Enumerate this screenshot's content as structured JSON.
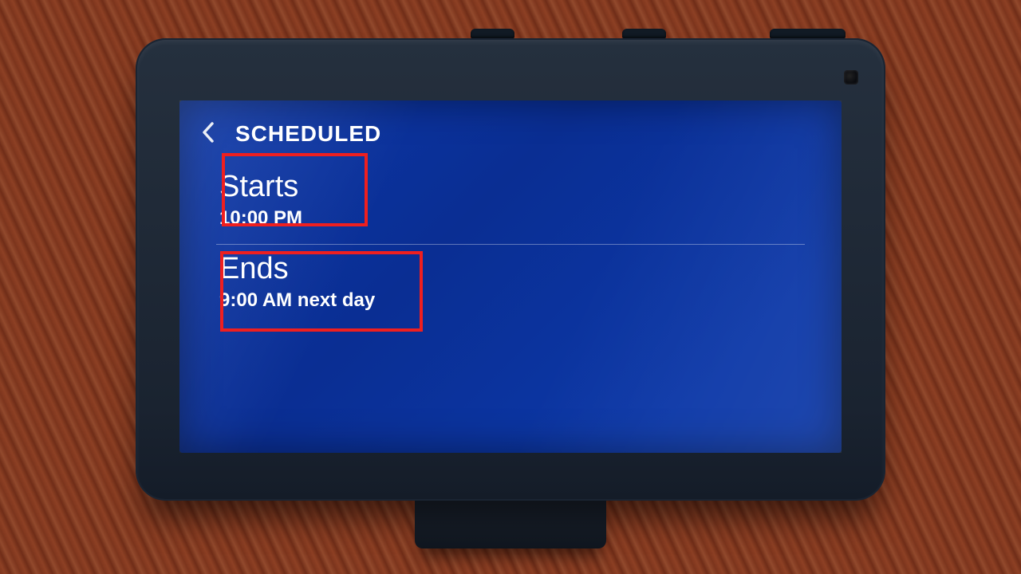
{
  "header": {
    "title": "SCHEDULED",
    "back_icon": "chevron-left-icon"
  },
  "schedule": {
    "start": {
      "label": "Starts",
      "value": "10:00 PM"
    },
    "end": {
      "label": "Ends",
      "value": "9:00 AM next day"
    }
  },
  "annotation": {
    "highlight_color": "#ef1f1f"
  }
}
